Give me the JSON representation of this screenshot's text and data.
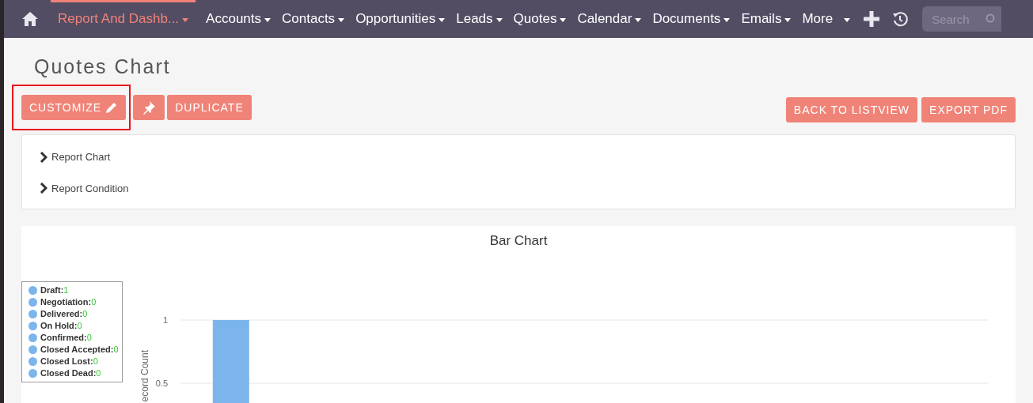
{
  "nav": {
    "items": [
      {
        "label": "Report And Dashb...",
        "selected": true
      },
      {
        "label": "Accounts",
        "selected": false
      },
      {
        "label": "Contacts",
        "selected": false
      },
      {
        "label": "Opportunities",
        "selected": false
      },
      {
        "label": "Leads",
        "selected": false
      },
      {
        "label": "Quotes",
        "selected": false
      },
      {
        "label": "Calendar",
        "selected": false
      },
      {
        "label": "Documents",
        "selected": false
      },
      {
        "label": "Emails",
        "selected": false
      },
      {
        "label": "More",
        "selected": false
      }
    ],
    "search": {
      "placeholder": "Search"
    }
  },
  "page_title": "Quotes Chart",
  "actions_left": [
    {
      "label": "CUSTOMIZE",
      "kind": "edit",
      "highlighted": true
    },
    {
      "kind": "pin"
    },
    {
      "label": "DUPLICATE",
      "kind": "text"
    }
  ],
  "actions_right": [
    "BACK TO LISTVIEW",
    "EXPORT PDF"
  ],
  "sections": [
    {
      "label": "Report Chart",
      "expanded": false
    },
    {
      "label": "Report Condition",
      "expanded": false
    }
  ],
  "legend": [
    {
      "label": "Draft:",
      "value": "1"
    },
    {
      "label": "Negotiation:",
      "value": "0"
    },
    {
      "label": "Delivered:",
      "value": "0"
    },
    {
      "label": "On Hold:",
      "value": "0"
    },
    {
      "label": "Confirmed:",
      "value": "0"
    },
    {
      "label": "Closed Accepted:",
      "value": "0"
    },
    {
      "label": "Closed Lost:",
      "value": "0"
    },
    {
      "label": "Closed Dead:",
      "value": "0"
    }
  ],
  "chart_data": {
    "type": "bar",
    "title": "Bar Chart",
    "ylabel": "ecord Count",
    "ylim": [
      0,
      1
    ],
    "yticks": [
      0.5,
      1
    ],
    "values": [
      1,
      0,
      0,
      0,
      0,
      0,
      0,
      0
    ]
  }
}
